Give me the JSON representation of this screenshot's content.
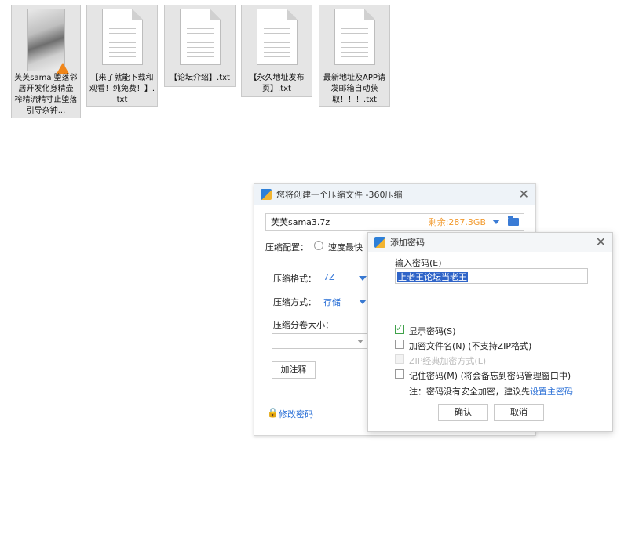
{
  "desktop": {
    "files": [
      {
        "name": "芙芙sama 堕落邻居开发化身精壶 榨精流精寸止堕落引导杂钟...",
        "type": "video-thumb"
      },
      {
        "name": "【来了就能下载和观看！纯免费！】.txt",
        "type": "txt"
      },
      {
        "name": "【论坛介绍】.txt",
        "type": "txt"
      },
      {
        "name": "【永久地址发布页】.txt",
        "type": "txt"
      },
      {
        "name": "最新地址及APP请发邮箱自动获取！！！.txt",
        "type": "txt"
      }
    ]
  },
  "compress_dialog": {
    "title": "您将创建一个压缩文件 -360压缩",
    "filename": "芙芙sama3.7z",
    "free_space": "剩余:287.3GB",
    "config_label": "压缩配置：",
    "config_option": "速度最快",
    "format_label": "压缩格式：",
    "format_value": "7Z",
    "method_label": "压缩方式：",
    "method_value": "存储",
    "split_label": "压缩分卷大小：",
    "comment_button": "加注释",
    "change_password_link": "修改密码"
  },
  "password_dialog": {
    "title": "添加密码",
    "input_label": "输入密码(E)",
    "password_value": "上老王论坛当老王",
    "show_password": {
      "label": "显示密码(S)",
      "checked": true
    },
    "encrypt_filenames": {
      "label": "加密文件名(N) (不支持ZIP格式)",
      "checked": false
    },
    "zip_classic": {
      "label": "ZIP经典加密方式(L)",
      "checked": false,
      "disabled": true
    },
    "remember_password": {
      "label": "记住密码(M) (将会备忘到密码管理窗口中)",
      "checked": false
    },
    "note_prefix": "注：密码没有安全加密，建议先",
    "note_link": "设置主密码",
    "ok_button": "确认",
    "cancel_button": "取消"
  },
  "colors": {
    "accent": "#2a6fd6",
    "orange": "#f29a2e",
    "check_green": "#3fa14a"
  }
}
